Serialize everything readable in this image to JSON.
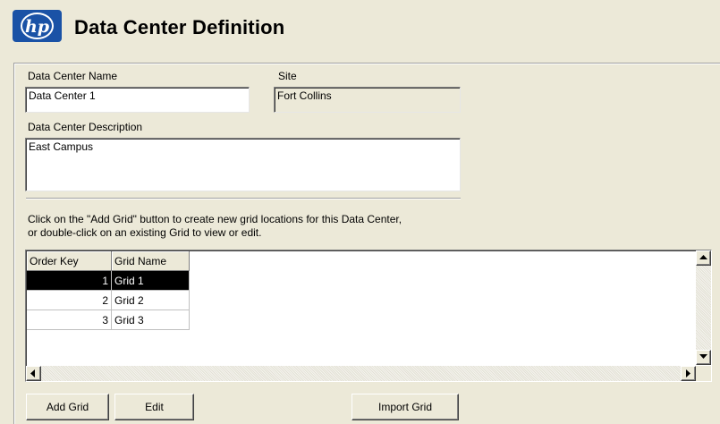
{
  "header": {
    "logo_text": "hp",
    "title": "Data Center Definition"
  },
  "form": {
    "name_label": "Data Center Name",
    "name_value": "Data Center 1",
    "site_label": "Site",
    "site_value": "Fort Collins",
    "description_label": "Data Center Description",
    "description_value": "East Campus"
  },
  "instructions": {
    "line1": "Click on the \"Add Grid\" button to create new grid locations for this Data Center,",
    "line2": "or double-click on an existing Grid to view or edit."
  },
  "grid": {
    "columns": [
      "Order Key",
      "Grid Name"
    ],
    "rows": [
      {
        "order_key": "1",
        "grid_name": "Grid 1",
        "selected": true
      },
      {
        "order_key": "2",
        "grid_name": "Grid 2",
        "selected": false
      },
      {
        "order_key": "3",
        "grid_name": "Grid 3",
        "selected": false
      }
    ]
  },
  "buttons": {
    "add_grid": "Add Grid",
    "edit": "Edit",
    "import_grid": "Import Grid"
  },
  "colors": {
    "window_bg": "#ece9d8",
    "logo_blue": "#1a52a6",
    "selection_bg": "#000000",
    "selection_fg": "#ffffff"
  }
}
